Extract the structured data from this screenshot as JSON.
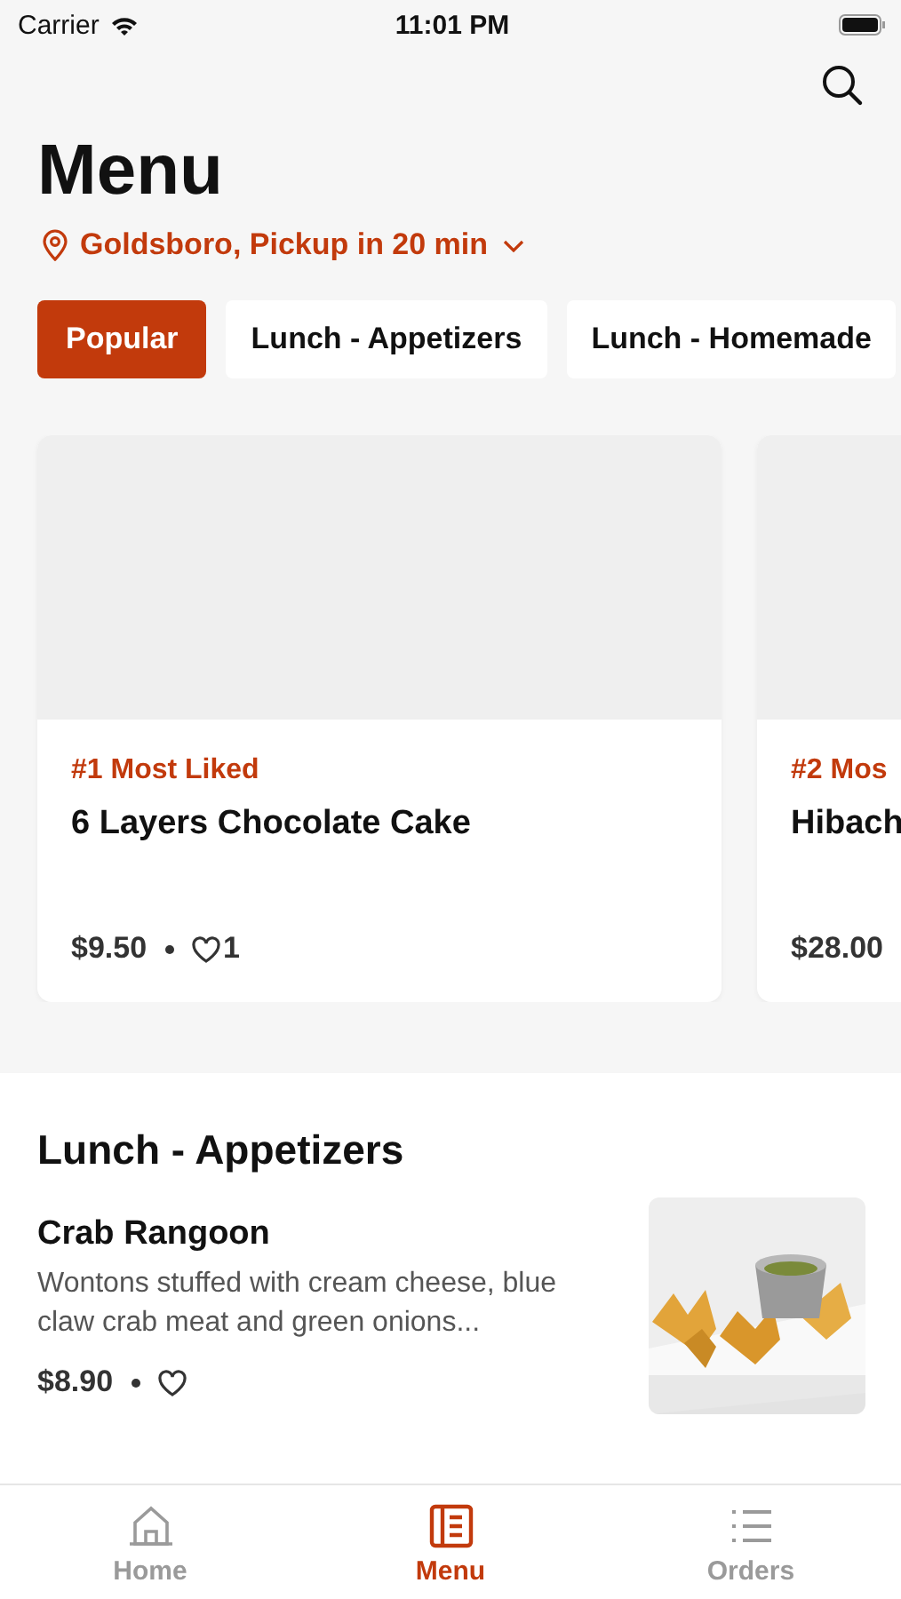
{
  "status_bar": {
    "carrier": "Carrier",
    "time": "11:01 PM"
  },
  "header": {
    "title": "Menu",
    "location": "Goldsboro, Pickup in 20 min"
  },
  "tabs": [
    {
      "label": "Popular",
      "selected": true
    },
    {
      "label": "Lunch - Appetizers",
      "selected": false
    },
    {
      "label": "Lunch - Homemade",
      "selected": false
    }
  ],
  "popular_cards": [
    {
      "rank": "#1 Most Liked",
      "name": "6 Layers Chocolate Cake",
      "price": "$9.50",
      "likes": "1"
    },
    {
      "rank": "#2 Mos",
      "name": "Hibach",
      "price": "$28.00"
    }
  ],
  "section": {
    "title": "Lunch - Appetizers",
    "items": [
      {
        "name": "Crab Rangoon",
        "description": "Wontons stuffed with cream cheese, blue claw crab meat and green onions...",
        "price": "$8.90"
      }
    ]
  },
  "bottom_nav": [
    {
      "label": "Home",
      "kind": "home",
      "selected": false
    },
    {
      "label": "Menu",
      "kind": "menu",
      "selected": true
    },
    {
      "label": "Orders",
      "kind": "orders",
      "selected": false
    }
  ]
}
